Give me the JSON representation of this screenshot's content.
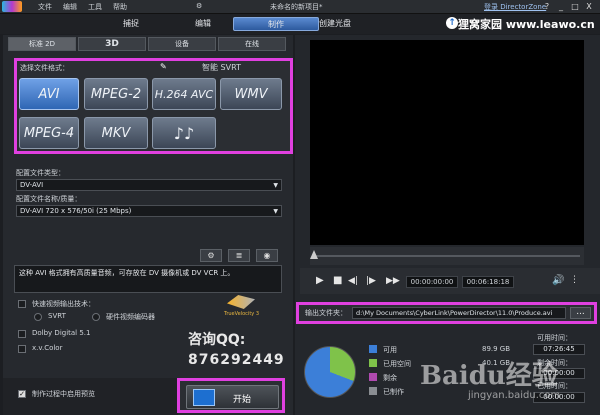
{
  "titlebar": {
    "menu": [
      "文件",
      "编辑",
      "工具",
      "帮助"
    ],
    "project": "未命名的新项目*",
    "login": "登录 DirectorZone",
    "help": "?",
    "minimize": "_",
    "maximize": "□",
    "close": "X"
  },
  "modes": [
    "捕捉",
    "编辑",
    "制作",
    "创建光盘"
  ],
  "logo": {
    "mark": "↑",
    "text": "狸窝家园 www.leawo.cn"
  },
  "subtabs": [
    "标准 2D",
    "3D",
    "设备",
    "在线"
  ],
  "format": {
    "label": "选择文件格式：",
    "svrt": "智能 SVRT",
    "buttons": [
      {
        "label": "AVI"
      },
      {
        "label": "MPEG-2"
      },
      {
        "label": "H.264 AVC"
      },
      {
        "label": "WMV"
      },
      {
        "label": "MPEG-4"
      },
      {
        "label": "MKV"
      },
      {
        "label": "♪♪"
      }
    ]
  },
  "profile": {
    "type_label": "配置文件类型：",
    "type_value": "DV-AVI",
    "name_label": "配置文件名称/质量：",
    "name_value": "DV-AVI 720 x 576/50i (25 Mbps)"
  },
  "description": "这种 AVI 格式拥有高质量音频，可存放在 DV 摄像机或 DV VCR 上。",
  "fast": {
    "label": "快速视频输出技术：",
    "svrt": "SVRT",
    "hw": "硬件视频编码器",
    "brand": "TrueVelocity 3"
  },
  "audio": [
    "Dolby Digital 5.1",
    "x.v.Color"
  ],
  "qq": {
    "line1": "咨询QQ:",
    "line2": "876292449"
  },
  "preview_check": "制作过程中启用预览",
  "start_label": "开始",
  "player": {
    "current": "00:00:00:00",
    "total": "00:06:18:18"
  },
  "output": {
    "label": "输出文件夹：",
    "path": "d:\\My Documents\\CyberLink\\PowerDirector\\11.0\\Produce.avi",
    "browse": "..."
  },
  "disk": {
    "legend": [
      {
        "name": "可用",
        "value": "89.9 GB",
        "color": "#3c7fd8"
      },
      {
        "name": "已用空间",
        "value": "40.1 GB",
        "color": "#7fc24a"
      },
      {
        "name": "剩余",
        "value": "",
        "color": "#b04ab0"
      },
      {
        "name": "已制作",
        "value": "",
        "color": "#8a8d92"
      }
    ],
    "times": [
      {
        "label": "可用时间：",
        "value": "07:26:45"
      },
      {
        "label": "剩余时间：",
        "value": "00:00:00"
      },
      {
        "label": "已用时间：",
        "value": "00:00:00"
      }
    ]
  },
  "watermark": {
    "main": "Baidu经验",
    "sub": "jingyan.baidu.com"
  }
}
